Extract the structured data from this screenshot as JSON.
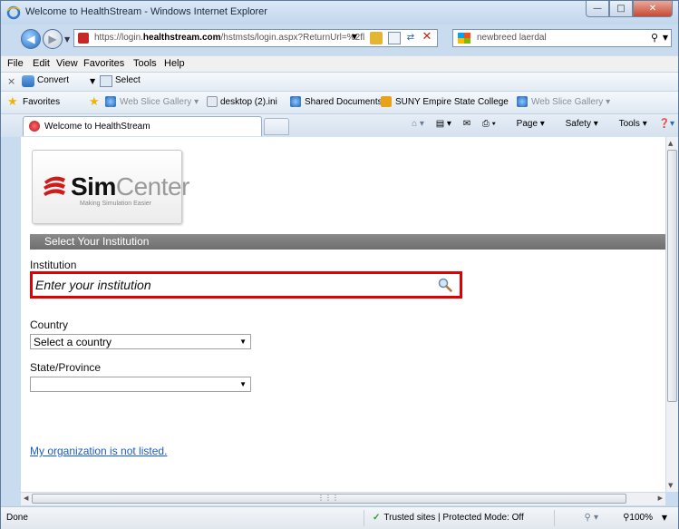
{
  "window": {
    "title": "Welcome to HealthStream - Windows Internet Explorer"
  },
  "address": {
    "url_prefix": "https://login.",
    "url_domain": "healthstream.com",
    "url_path": "/hstmsts/login.aspx?ReturnUrl=%2fl"
  },
  "search": {
    "text": "newbreed laerdal"
  },
  "menu": {
    "file": "File",
    "edit": "Edit",
    "view": "View",
    "favorites": "Favorites",
    "tools": "Tools",
    "help": "Help"
  },
  "command": {
    "convert": "Convert",
    "select": "Select"
  },
  "favbar": {
    "favorites": "Favorites",
    "web_slice_1": "Web Slice Gallery",
    "desktop": "desktop (2).ini",
    "shared": "Shared Documents",
    "suny": "SUNY Empire State College",
    "web_slice_2": "Web Slice Gallery"
  },
  "tab": {
    "label": "Welcome to HealthStream"
  },
  "toolbar": {
    "page": "Page",
    "safety": "Safety",
    "tools": "Tools"
  },
  "logo": {
    "brand_bold": "Sim",
    "brand_light": "Center",
    "tagline": "Making Simulation Easier"
  },
  "form": {
    "section_title": "Select Your Institution",
    "institution_label": "Institution",
    "institution_placeholder": "Enter your institution",
    "country_label": "Country",
    "country_value": "Select a country",
    "state_label": "State/Province",
    "state_value": "",
    "not_listed_link": "My organization is not listed."
  },
  "status": {
    "left": "Done",
    "zone": "Trusted sites | Protected Mode: Off",
    "zoom": "100%"
  },
  "colors": {
    "highlight": "#e00000",
    "link": "#1a5cc7",
    "section_bar": "#7a7a7a"
  }
}
